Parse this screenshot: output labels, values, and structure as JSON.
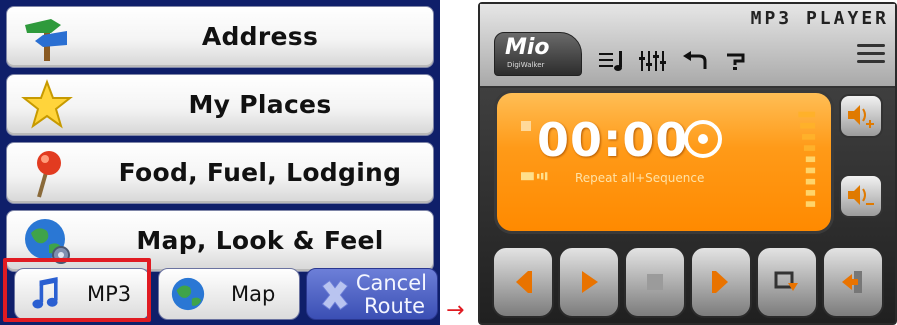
{
  "menu": {
    "items": [
      {
        "label": "Address",
        "icon": "signpost-icon"
      },
      {
        "label": "My Places",
        "icon": "star-icon"
      },
      {
        "label": "Food, Fuel, Lodging",
        "icon": "map-pin-icon"
      },
      {
        "label": "Map, Look & Feel",
        "icon": "globe-gear-icon"
      }
    ]
  },
  "bottom_bar": {
    "mp3_label": "MP3",
    "map_label": "Map",
    "cancel_label_line1": "Cancel",
    "cancel_label_line2": "Route"
  },
  "annotation": {
    "arrow": "→"
  },
  "player": {
    "title": "MP3 PLAYER",
    "logo": "Mio",
    "logo_sub": "DigiWalker",
    "time": "00:00",
    "status": "Repeat all+Sequence"
  },
  "colors": {
    "nav_bg": "#0f1f6a",
    "highlight": "#e01b22",
    "display_orange": "#ff9a18",
    "cancel_blue": "#4a5fc4"
  }
}
